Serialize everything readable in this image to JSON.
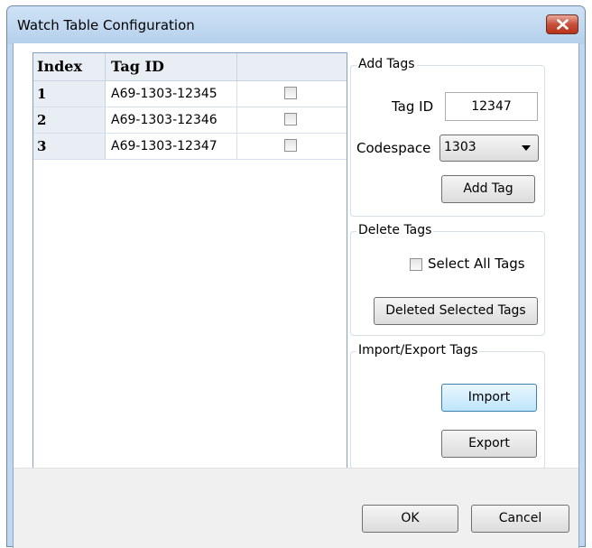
{
  "window": {
    "title": "Watch Table Configuration"
  },
  "grid": {
    "headers": [
      "Index",
      "Tag ID",
      ""
    ],
    "rows": [
      {
        "index": "1",
        "tag_id": "A69-1303-12345",
        "checked": false
      },
      {
        "index": "2",
        "tag_id": "A69-1303-12346",
        "checked": false
      },
      {
        "index": "3",
        "tag_id": "A69-1303-12347",
        "checked": false
      }
    ]
  },
  "add_tags": {
    "group_label": "Add Tags",
    "tag_id_label": "Tag ID",
    "tag_id_value": "12347",
    "codespace_label": "Codespace",
    "codespace_value": "1303",
    "add_button": "Add Tag"
  },
  "delete_tags": {
    "group_label": "Delete Tags",
    "select_all_label": "Select All Tags",
    "select_all_checked": false,
    "delete_button": "Deleted Selected Tags"
  },
  "import_export": {
    "group_label": "Import/Export Tags",
    "import_button": "Import",
    "export_button": "Export"
  },
  "footer": {
    "ok_button": "OK",
    "cancel_button": "Cancel"
  },
  "colors": {
    "title_bar": "#bfd7ef",
    "close_button": "#c7513b",
    "grid_header_bg": "#e9eef5",
    "focus_button": "#bee6fd"
  },
  "icons": {
    "close": "close-icon",
    "dropdown": "chevron-down-icon"
  }
}
